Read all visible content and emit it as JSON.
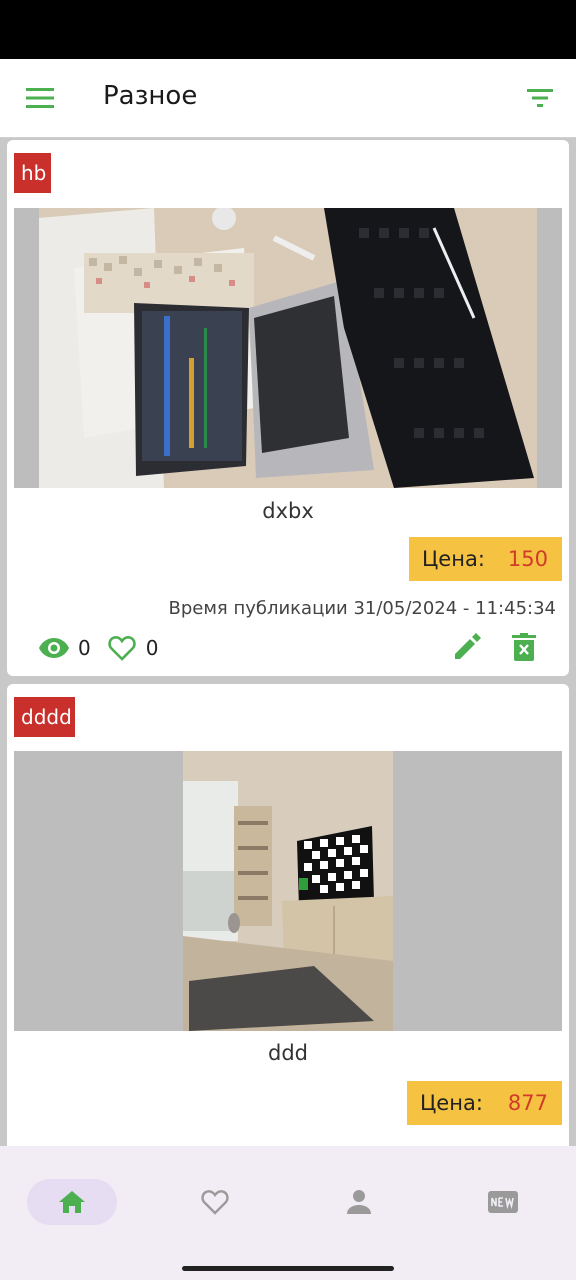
{
  "app_bar": {
    "title": "Разное",
    "menu_icon": "menu-icon",
    "filter_icon": "filter-icon"
  },
  "colors": {
    "accent_green": "#4caf50",
    "badge_red": "#c9302c",
    "price_bg": "#f5c242",
    "price_text": "#d13b2a",
    "nav_active_bg": "#e6ddf2"
  },
  "listings": [
    {
      "category": "hb",
      "name": "dxbx",
      "price_label": "Цена:",
      "price": "150",
      "published": "Время публикации 31/05/2024 - 11:45:34",
      "views": "0",
      "likes": "0",
      "image": "photo of laptop and keyboard on desk"
    },
    {
      "category": "dddd",
      "name": "ddd",
      "price_label": "Цена:",
      "price": "877",
      "image": "photo of room interior with TV"
    }
  ],
  "bottom_nav": {
    "items": [
      {
        "icon": "home-icon",
        "active": true
      },
      {
        "icon": "heart-icon",
        "active": false
      },
      {
        "icon": "person-icon",
        "active": false
      },
      {
        "icon": "new-badge-icon",
        "active": false
      }
    ]
  }
}
